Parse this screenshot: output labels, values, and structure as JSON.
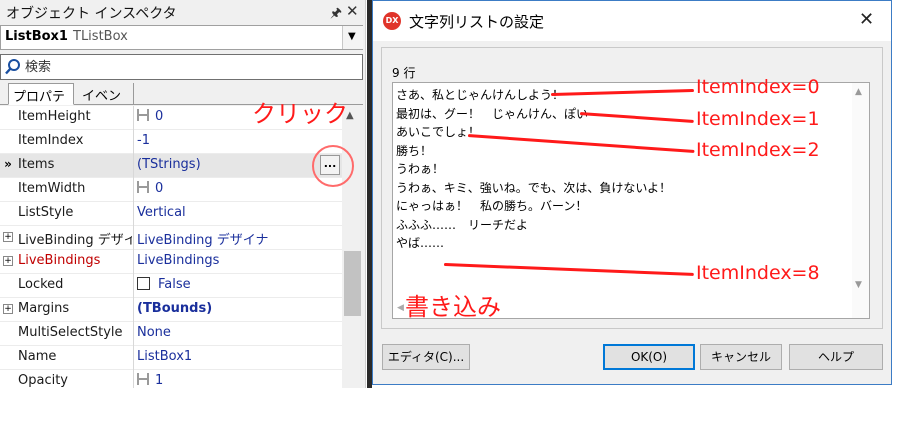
{
  "inspector": {
    "title": "オブジェクト インスペクタ",
    "component_name": "ListBox1",
    "component_class": "TListBox",
    "search_placeholder": "検索",
    "tabs": [
      "プロパティ",
      "イベント"
    ],
    "rows": [
      {
        "name": "ItemHeight",
        "value": "0",
        "kind": "grid"
      },
      {
        "name": "ItemIndex",
        "value": "-1",
        "kind": "plain"
      },
      {
        "name": "Items",
        "value": "(TStrings)",
        "kind": "selected"
      },
      {
        "name": "ItemWidth",
        "value": "0",
        "kind": "grid"
      },
      {
        "name": "ListStyle",
        "value": "Vertical",
        "kind": "plain"
      },
      {
        "name": "LiveBinding デザイナ",
        "value": "LiveBinding デザイナ",
        "kind": "expand"
      },
      {
        "name": "LiveBindings",
        "value": "LiveBindings",
        "kind": "red"
      },
      {
        "name": "Locked",
        "value": "False",
        "kind": "check"
      },
      {
        "name": "Margins",
        "value": "(TBounds)",
        "kind": "expand-bold"
      },
      {
        "name": "MultiSelectStyle",
        "value": "None",
        "kind": "plain"
      },
      {
        "name": "Name",
        "value": "ListBox1",
        "kind": "plain"
      },
      {
        "name": "Opacity",
        "value": "1",
        "kind": "grid"
      }
    ],
    "selected_marker": "»",
    "ellipsis_label": "..."
  },
  "dialog": {
    "title": "文字列リストの設定",
    "app_icon_text": "DX",
    "line_count": "9 行",
    "lines": [
      "さあ、私とじゃんけんしよう！",
      "最初は、グー！　じゃんけん、ぽい",
      "あいこでしょ！",
      "勝ち！",
      "うわぁ！",
      "うわぁ、キミ、強いね。でも、次は、負けないよ！",
      "にゃっはぁ！　私の勝ち。バーン！",
      "ふふふ……　リーチだよ",
      "やば……"
    ],
    "buttons": {
      "editor": "エディタ(C)...",
      "ok": "OK(O)",
      "cancel": "キャンセル",
      "help": "ヘルプ"
    }
  },
  "annotations": {
    "click": "クリック",
    "write": "書き込み",
    "index_labels": [
      "ItemIndex=0",
      "ItemIndex=1",
      "ItemIndex=2",
      "ItemIndex=8"
    ],
    "color": "#ff1a1a"
  }
}
